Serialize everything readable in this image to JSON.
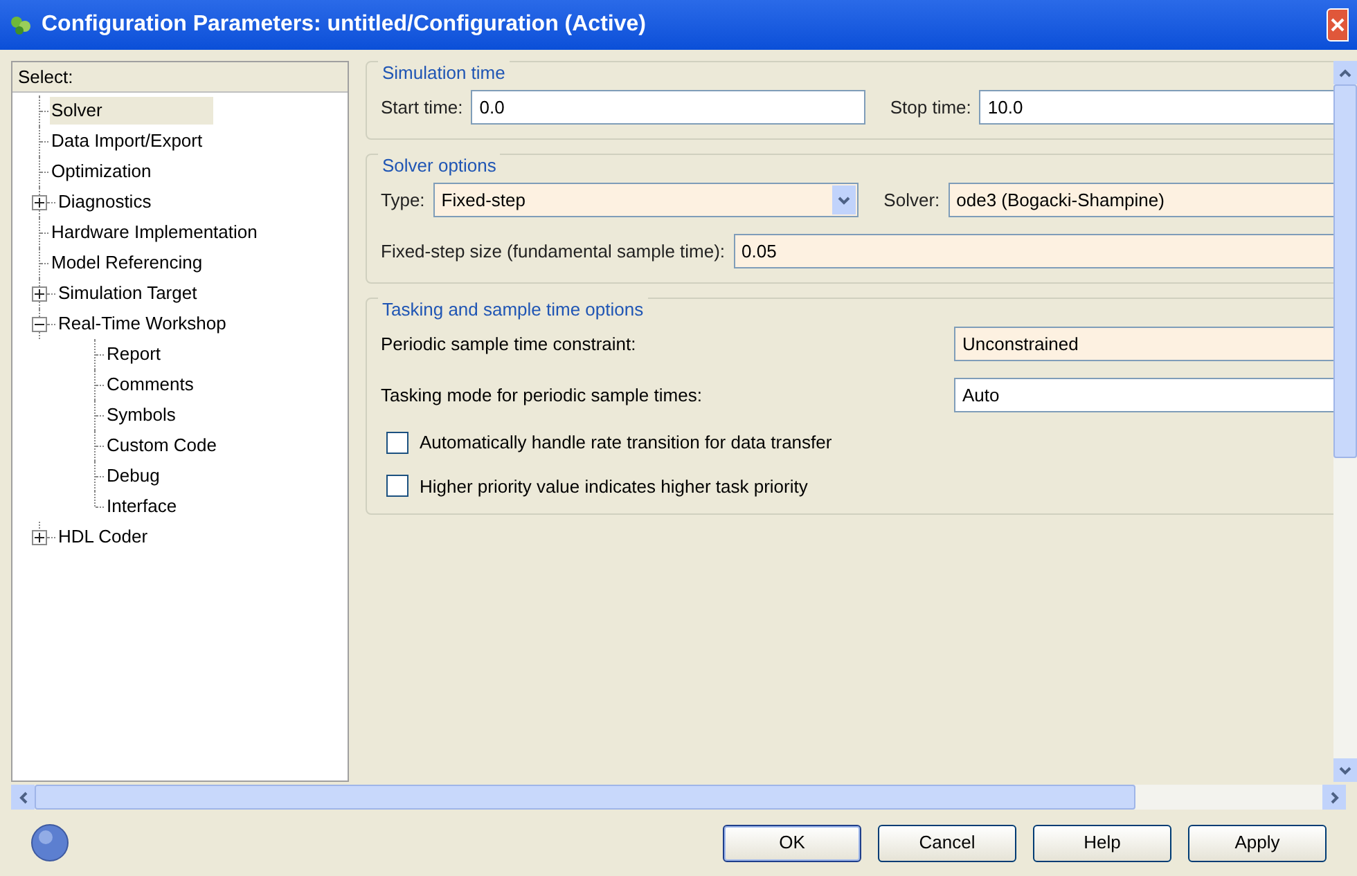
{
  "window": {
    "title": "Configuration Parameters: untitled/Configuration (Active)"
  },
  "tree": {
    "header": "Select:",
    "items": [
      {
        "label": "Solver",
        "kind": "leaf",
        "selected": true
      },
      {
        "label": "Data Import/Export",
        "kind": "leaf",
        "selected": false
      },
      {
        "label": "Optimization",
        "kind": "leaf",
        "selected": false
      },
      {
        "label": "Diagnostics",
        "kind": "node",
        "expanded": false,
        "selected": false
      },
      {
        "label": "Hardware Implementation",
        "kind": "leaf",
        "selected": false
      },
      {
        "label": "Model Referencing",
        "kind": "leaf",
        "selected": false
      },
      {
        "label": "Simulation Target",
        "kind": "node",
        "expanded": false,
        "selected": false
      },
      {
        "label": "Real-Time Workshop",
        "kind": "node",
        "expanded": true,
        "selected": false,
        "children": [
          {
            "label": "Report",
            "kind": "leaf",
            "selected": false
          },
          {
            "label": "Comments",
            "kind": "leaf",
            "selected": false
          },
          {
            "label": "Symbols",
            "kind": "leaf",
            "selected": false
          },
          {
            "label": "Custom Code",
            "kind": "leaf",
            "selected": false
          },
          {
            "label": "Debug",
            "kind": "leaf",
            "selected": false
          },
          {
            "label": "Interface",
            "kind": "leaf",
            "selected": false
          }
        ]
      },
      {
        "label": "HDL Coder",
        "kind": "node",
        "expanded": false,
        "selected": false
      }
    ]
  },
  "groups": [
    {
      "title": "Simulation time",
      "rows": [
        {
          "kind": "pair",
          "fields": [
            {
              "label": "Start time:",
              "value": "0.0",
              "kind": "text",
              "highlighted": false
            },
            {
              "label": "Stop time:",
              "value": "10.0",
              "kind": "text",
              "highlighted": false
            }
          ]
        }
      ]
    },
    {
      "title": "Solver options",
      "rows": [
        {
          "kind": "pair",
          "fields": [
            {
              "label": "Type:",
              "value": "Fixed-step",
              "kind": "dropdown",
              "highlighted": true
            },
            {
              "label": "Solver:",
              "value": "ode3 (Bogacki-Shampine)",
              "kind": "text",
              "highlighted": true
            }
          ]
        },
        {
          "kind": "single",
          "fields": [
            {
              "label": "Fixed-step size (fundamental sample time):",
              "value": "0.05",
              "kind": "text",
              "highlighted": true
            }
          ]
        }
      ]
    },
    {
      "title": "Tasking and sample time options",
      "rows": [
        {
          "kind": "wide",
          "fields": [
            {
              "label": "Periodic sample time constraint:",
              "value": "Unconstrained",
              "kind": "text",
              "highlighted": true
            }
          ]
        },
        {
          "kind": "wide",
          "fields": [
            {
              "label": "Tasking mode for periodic sample times:",
              "value": "Auto",
              "kind": "text",
              "highlighted": false
            }
          ]
        },
        {
          "kind": "checkbox",
          "label": "Automatically handle rate transition for data transfer",
          "checked": false
        },
        {
          "kind": "checkbox",
          "label": "Higher priority value indicates higher task priority",
          "checked": false
        }
      ]
    }
  ],
  "buttons": [
    {
      "label": "OK",
      "default": true
    },
    {
      "label": "Cancel",
      "default": false
    },
    {
      "label": "Help",
      "default": false
    },
    {
      "label": "Apply",
      "default": false
    }
  ]
}
